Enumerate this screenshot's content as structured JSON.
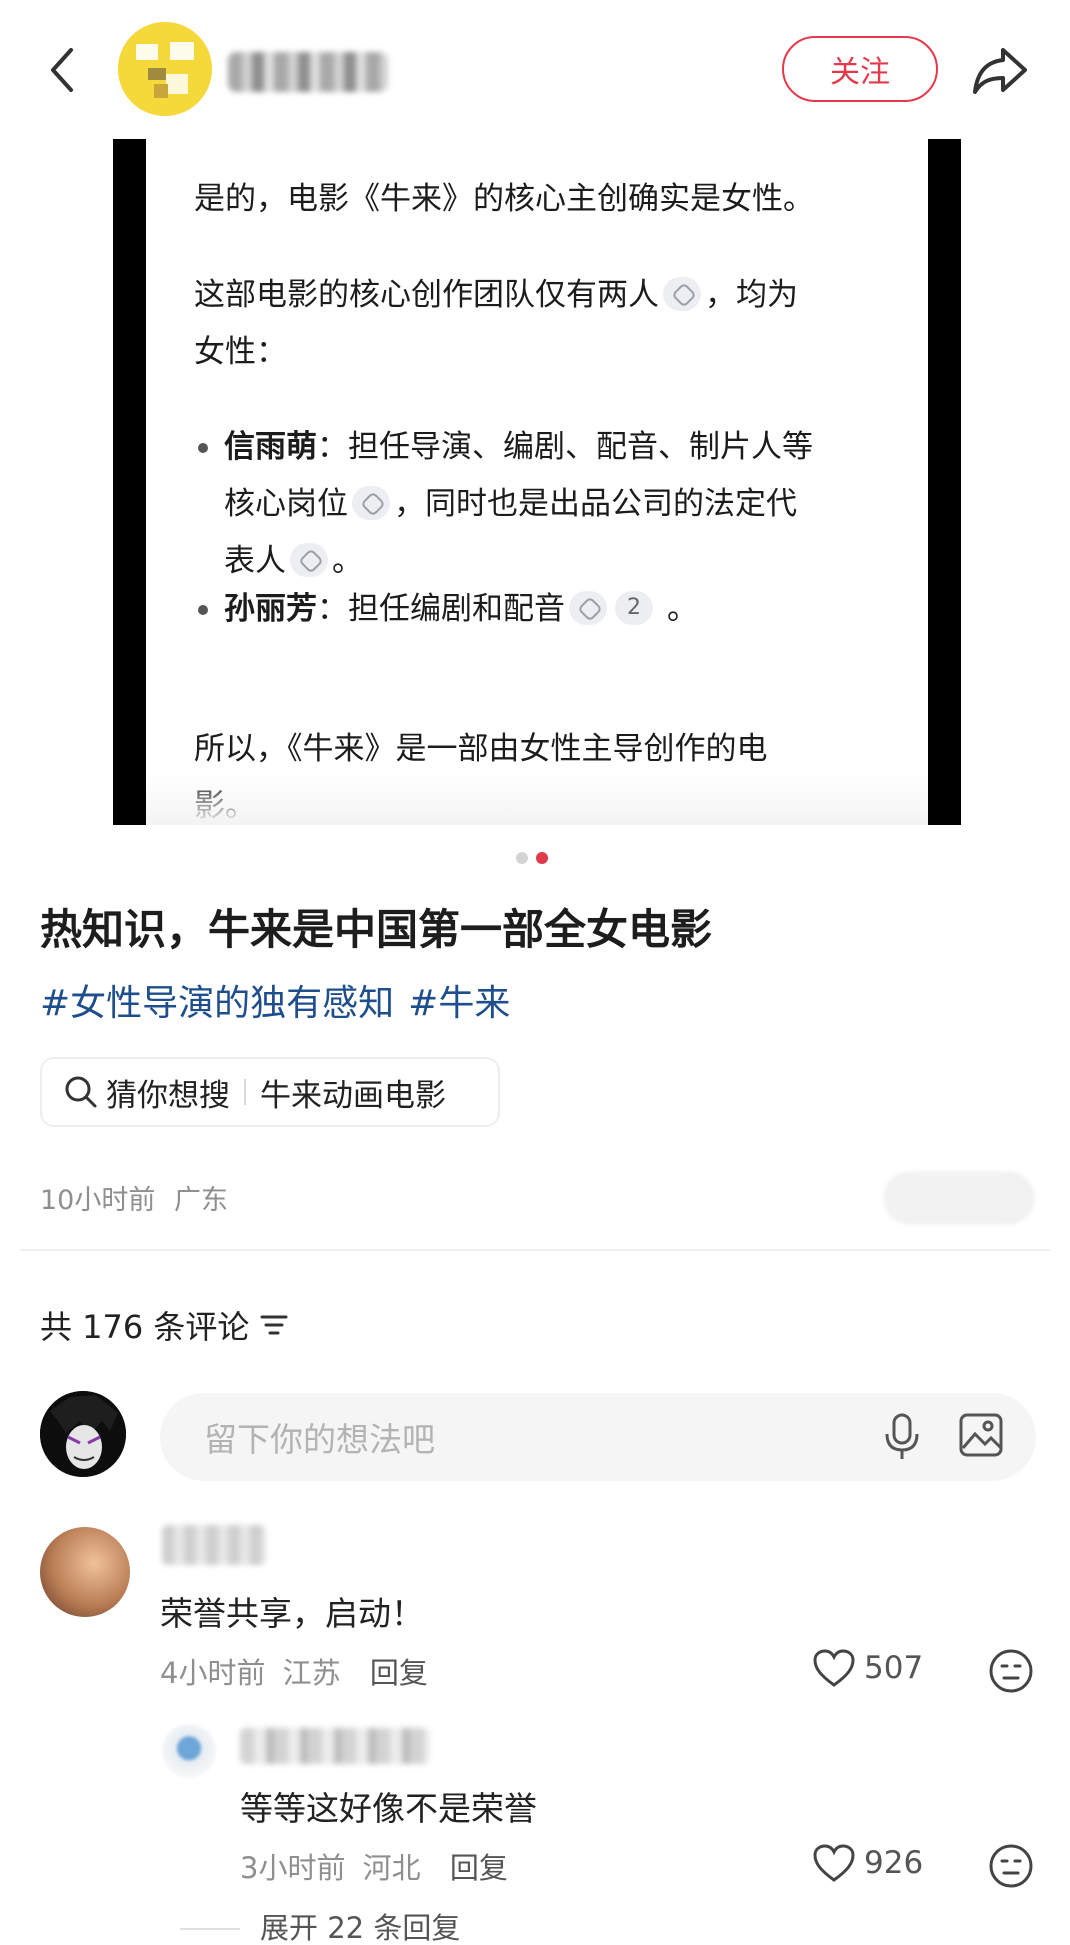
{
  "header": {
    "follow_label": "关注",
    "colors": {
      "accent": "#e33a4b"
    }
  },
  "card": {
    "p1": "是的，电影《牛来》的核心主创确实是女性。",
    "p2a": "这部电影的核心创作团队仅有两人",
    "p2b": "，均为",
    "p2c": "女性：",
    "b1_name": "信雨萌",
    "b1_l1": "：担任导演、编剧、配音、制片人等",
    "b1_l2a": "核心岗位",
    "b1_l2b": "，同时也是出品公司的法定代",
    "b1_l3a": "表人",
    "b1_l3b": "。",
    "b2_name": "孙丽芳",
    "b2_text": "：担任编剧和配音",
    "b2_num": "2",
    "b2_end": "。",
    "p3a": "所以，《牛来》是一部由女性主导创作的电",
    "p3b": "影。"
  },
  "carousel": {
    "total": 2,
    "active": 2
  },
  "post": {
    "title": "热知识，牛来是中国第一部全女电影",
    "hashtags": [
      "#女性导演的独有感知",
      "#牛来"
    ],
    "guess_label": "猜你想搜",
    "guess_term": "牛来动画电影",
    "time": "10小时前",
    "location": "广东"
  },
  "comments": {
    "count_label": "共 176 条评论",
    "input_placeholder": "留下你的想法吧",
    "items": [
      {
        "text": "荣誉共享，启动！",
        "time": "4小时前",
        "location": "江苏",
        "reply_label": "回复",
        "likes": "507"
      },
      {
        "text": "等等这好像不是荣誉",
        "time": "3小时前",
        "location": "河北",
        "reply_label": "回复",
        "likes": "926"
      }
    ],
    "expand_label": "展开 22 条回复"
  }
}
